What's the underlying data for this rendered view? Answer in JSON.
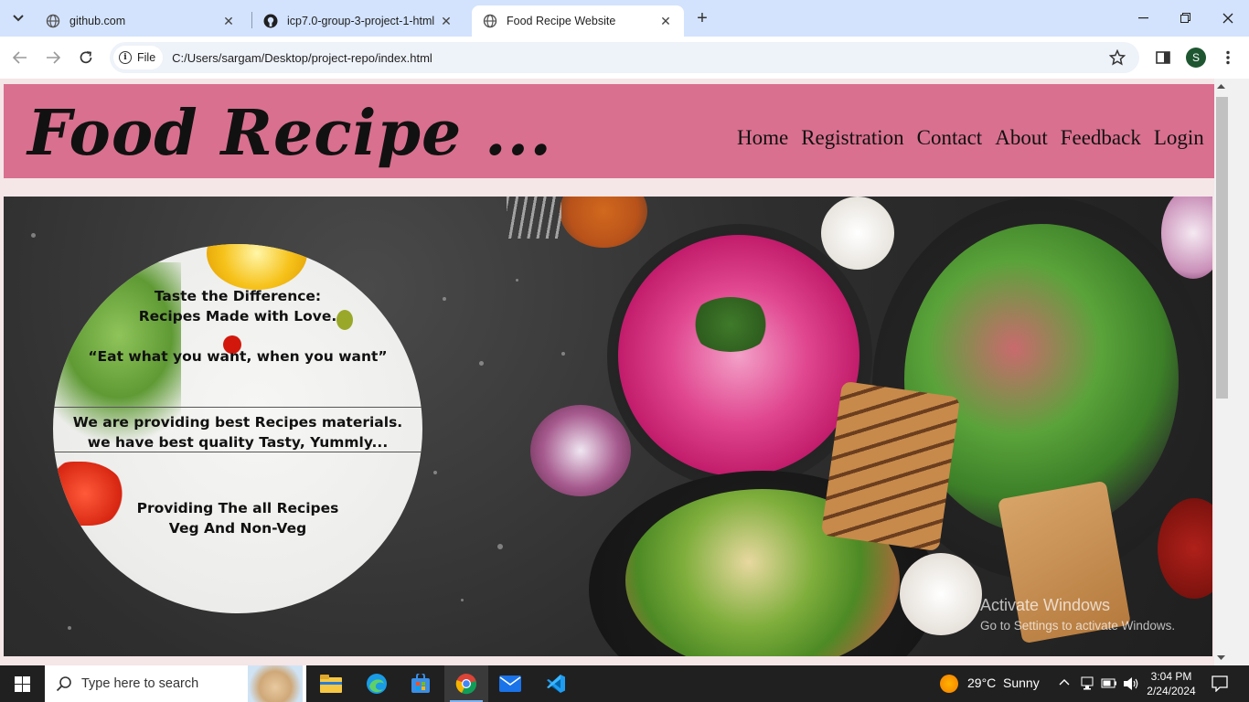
{
  "browser": {
    "tabs": [
      {
        "title": "github.com",
        "active": false
      },
      {
        "title": "icp7.0-group-3-project-1-html",
        "active": false
      },
      {
        "title": "Food Recipe Website",
        "active": true
      }
    ],
    "address": {
      "chip_label": "File",
      "url": "C:/Users/sargam/Desktop/project-repo/index.html"
    },
    "profile_initial": "S"
  },
  "site": {
    "logo": "Food Recipe ...",
    "nav": [
      "Home",
      "Registration",
      "Contact",
      "About",
      "Feedback",
      "Login"
    ],
    "colors": {
      "header_bg": "#d9708f",
      "page_bg": "#f5e6e8"
    }
  },
  "hero": {
    "tagline_line1": "Taste the Difference:",
    "tagline_line2": "Recipes Made with Love.",
    "quote": "“Eat what you want, when you want”",
    "promo_line1": "We are providing best Recipes materials.",
    "promo_line2": "we have best quality Tasty, Yummly...",
    "offer_line1": "Providing The all Recipes",
    "offer_line2": "Veg And Non-Veg"
  },
  "watermark": {
    "title": "Activate Windows",
    "subtitle": "Go to Settings to activate Windows."
  },
  "taskbar": {
    "search_placeholder": "Type here to search",
    "weather_temp": "29°C",
    "weather_text": "Sunny",
    "time": "3:04 PM",
    "date": "2/24/2024"
  }
}
